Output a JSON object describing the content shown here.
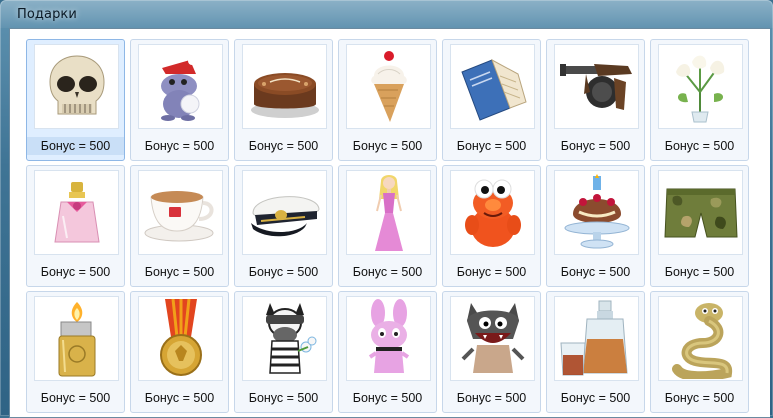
{
  "window": {
    "title": "Подарки"
  },
  "gifts": [
    {
      "label": "Бонус = 500",
      "icon": "skull-icon"
    },
    {
      "label": "Бонус = 500",
      "icon": "hippo-santa-icon"
    },
    {
      "label": "Бонус = 500",
      "icon": "cake-icon"
    },
    {
      "label": "Бонус = 500",
      "icon": "ice-cream-icon"
    },
    {
      "label": "Бонус = 500",
      "icon": "book-icon"
    },
    {
      "label": "Бонус = 500",
      "icon": "tommy-gun-icon"
    },
    {
      "label": "Бонус = 500",
      "icon": "calla-flowers-icon"
    },
    {
      "label": "Бонус = 500",
      "icon": "perfume-icon"
    },
    {
      "label": "Бонус = 500",
      "icon": "coffee-cup-icon"
    },
    {
      "label": "Бонус = 500",
      "icon": "captain-cap-icon"
    },
    {
      "label": "Бонус = 500",
      "icon": "doll-icon"
    },
    {
      "label": "Бонус = 500",
      "icon": "red-monster-icon"
    },
    {
      "label": "Бонус = 500",
      "icon": "birthday-dessert-icon"
    },
    {
      "label": "Бонус = 500",
      "icon": "camo-shorts-icon"
    },
    {
      "label": "Бонус = 500",
      "icon": "lighter-icon"
    },
    {
      "label": "Бонус = 500",
      "icon": "medal-icon"
    },
    {
      "label": "Бонус = 500",
      "icon": "zebra-icon"
    },
    {
      "label": "Бонус = 500",
      "icon": "pink-bunny-icon"
    },
    {
      "label": "Бонус = 500",
      "icon": "cartoon-wolf-icon"
    },
    {
      "label": "Бонус = 500",
      "icon": "whiskey-decanter-icon"
    },
    {
      "label": "Бонус = 500",
      "icon": "snake-icon"
    }
  ],
  "selected_index": 0,
  "colors": {
    "selected_bg": "#dfeeff",
    "selected_label_bg": "#c9dff7",
    "cell_border": "#c7d7ea"
  }
}
